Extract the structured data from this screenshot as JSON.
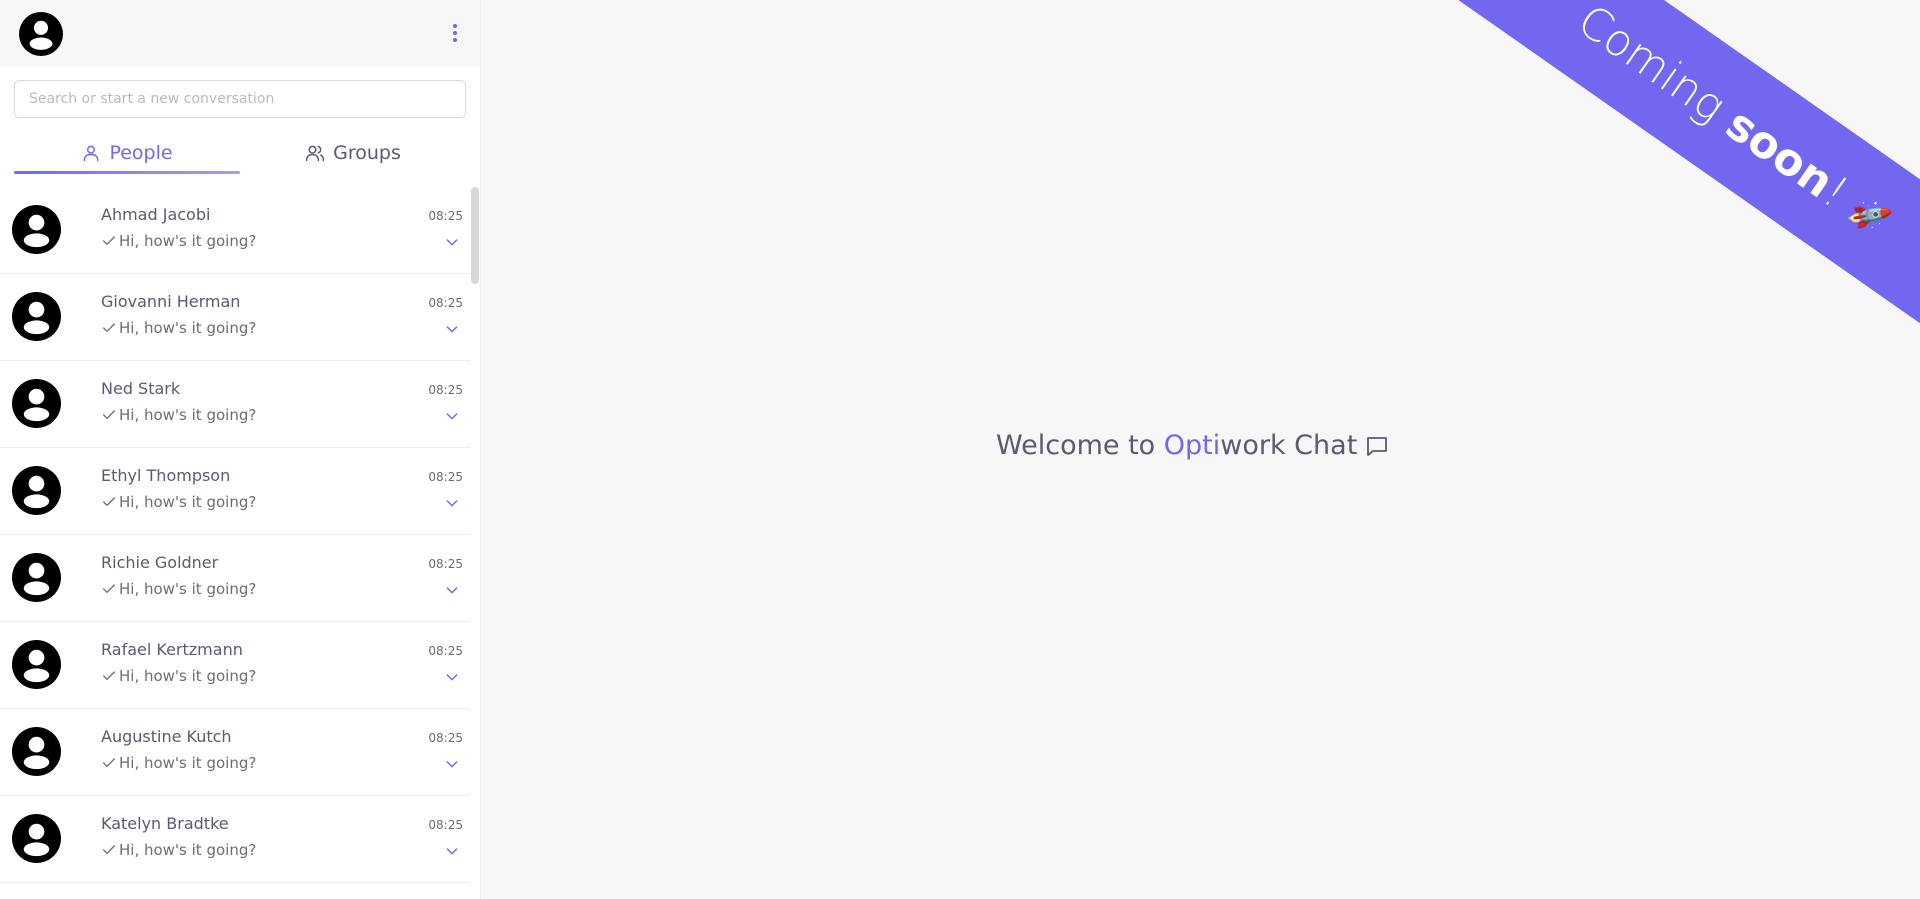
{
  "sidebar": {
    "search_placeholder": "Search or start a new conversation",
    "tabs": [
      {
        "label": "People",
        "icon": "user-icon",
        "active": true
      },
      {
        "label": "Groups",
        "icon": "users-icon",
        "active": false
      }
    ],
    "conversations": [
      {
        "name": "Ahmad Jacobi",
        "time": "08:25",
        "message": "Hi, how's it going?"
      },
      {
        "name": "Giovanni Herman",
        "time": "08:25",
        "message": "Hi, how's it going?"
      },
      {
        "name": "Ned Stark",
        "time": "08:25",
        "message": "Hi, how's it going?"
      },
      {
        "name": "Ethyl Thompson",
        "time": "08:25",
        "message": "Hi, how's it going?"
      },
      {
        "name": "Richie Goldner",
        "time": "08:25",
        "message": "Hi, how's it going?"
      },
      {
        "name": "Rafael Kertzmann",
        "time": "08:25",
        "message": "Hi, how's it going?"
      },
      {
        "name": "Augustine Kutch",
        "time": "08:25",
        "message": "Hi, how's it going?"
      },
      {
        "name": "Katelyn Bradtke",
        "time": "08:25",
        "message": "Hi, how's it going?"
      }
    ]
  },
  "main": {
    "welcome_prefix": "Welcome to ",
    "welcome_accent": "Opti",
    "welcome_suffix": "work Chat",
    "ribbon_light": "Coming ",
    "ribbon_bold": "soon",
    "ribbon_end": "!",
    "ribbon_emoji": "🚀"
  },
  "colors": {
    "accent": "#7367f0",
    "text": "#5e5873",
    "muted": "#6e6b7b",
    "background": "#f7f7f7"
  }
}
